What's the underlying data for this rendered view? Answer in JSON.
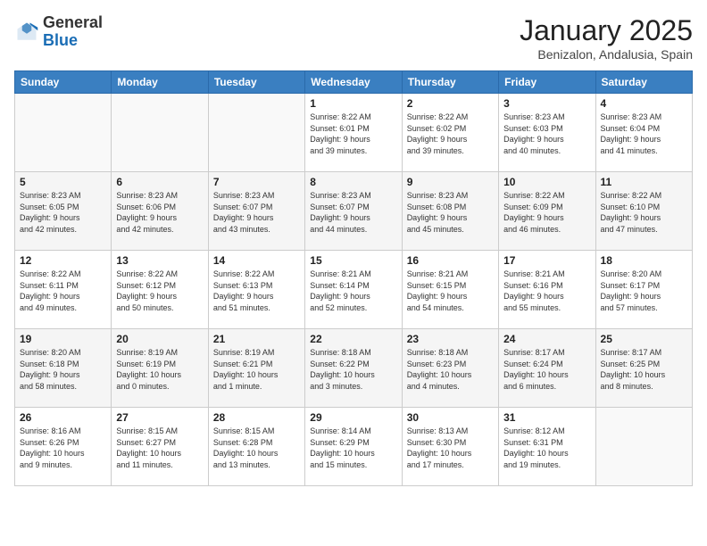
{
  "logo": {
    "general": "General",
    "blue": "Blue"
  },
  "header": {
    "month": "January 2025",
    "location": "Benizalon, Andalusia, Spain"
  },
  "weekdays": [
    "Sunday",
    "Monday",
    "Tuesday",
    "Wednesday",
    "Thursday",
    "Friday",
    "Saturday"
  ],
  "weeks": [
    [
      {
        "day": "",
        "info": ""
      },
      {
        "day": "",
        "info": ""
      },
      {
        "day": "",
        "info": ""
      },
      {
        "day": "1",
        "info": "Sunrise: 8:22 AM\nSunset: 6:01 PM\nDaylight: 9 hours\nand 39 minutes."
      },
      {
        "day": "2",
        "info": "Sunrise: 8:22 AM\nSunset: 6:02 PM\nDaylight: 9 hours\nand 39 minutes."
      },
      {
        "day": "3",
        "info": "Sunrise: 8:23 AM\nSunset: 6:03 PM\nDaylight: 9 hours\nand 40 minutes."
      },
      {
        "day": "4",
        "info": "Sunrise: 8:23 AM\nSunset: 6:04 PM\nDaylight: 9 hours\nand 41 minutes."
      }
    ],
    [
      {
        "day": "5",
        "info": "Sunrise: 8:23 AM\nSunset: 6:05 PM\nDaylight: 9 hours\nand 42 minutes."
      },
      {
        "day": "6",
        "info": "Sunrise: 8:23 AM\nSunset: 6:06 PM\nDaylight: 9 hours\nand 42 minutes."
      },
      {
        "day": "7",
        "info": "Sunrise: 8:23 AM\nSunset: 6:07 PM\nDaylight: 9 hours\nand 43 minutes."
      },
      {
        "day": "8",
        "info": "Sunrise: 8:23 AM\nSunset: 6:07 PM\nDaylight: 9 hours\nand 44 minutes."
      },
      {
        "day": "9",
        "info": "Sunrise: 8:23 AM\nSunset: 6:08 PM\nDaylight: 9 hours\nand 45 minutes."
      },
      {
        "day": "10",
        "info": "Sunrise: 8:22 AM\nSunset: 6:09 PM\nDaylight: 9 hours\nand 46 minutes."
      },
      {
        "day": "11",
        "info": "Sunrise: 8:22 AM\nSunset: 6:10 PM\nDaylight: 9 hours\nand 47 minutes."
      }
    ],
    [
      {
        "day": "12",
        "info": "Sunrise: 8:22 AM\nSunset: 6:11 PM\nDaylight: 9 hours\nand 49 minutes."
      },
      {
        "day": "13",
        "info": "Sunrise: 8:22 AM\nSunset: 6:12 PM\nDaylight: 9 hours\nand 50 minutes."
      },
      {
        "day": "14",
        "info": "Sunrise: 8:22 AM\nSunset: 6:13 PM\nDaylight: 9 hours\nand 51 minutes."
      },
      {
        "day": "15",
        "info": "Sunrise: 8:21 AM\nSunset: 6:14 PM\nDaylight: 9 hours\nand 52 minutes."
      },
      {
        "day": "16",
        "info": "Sunrise: 8:21 AM\nSunset: 6:15 PM\nDaylight: 9 hours\nand 54 minutes."
      },
      {
        "day": "17",
        "info": "Sunrise: 8:21 AM\nSunset: 6:16 PM\nDaylight: 9 hours\nand 55 minutes."
      },
      {
        "day": "18",
        "info": "Sunrise: 8:20 AM\nSunset: 6:17 PM\nDaylight: 9 hours\nand 57 minutes."
      }
    ],
    [
      {
        "day": "19",
        "info": "Sunrise: 8:20 AM\nSunset: 6:18 PM\nDaylight: 9 hours\nand 58 minutes."
      },
      {
        "day": "20",
        "info": "Sunrise: 8:19 AM\nSunset: 6:19 PM\nDaylight: 10 hours\nand 0 minutes."
      },
      {
        "day": "21",
        "info": "Sunrise: 8:19 AM\nSunset: 6:21 PM\nDaylight: 10 hours\nand 1 minute."
      },
      {
        "day": "22",
        "info": "Sunrise: 8:18 AM\nSunset: 6:22 PM\nDaylight: 10 hours\nand 3 minutes."
      },
      {
        "day": "23",
        "info": "Sunrise: 8:18 AM\nSunset: 6:23 PM\nDaylight: 10 hours\nand 4 minutes."
      },
      {
        "day": "24",
        "info": "Sunrise: 8:17 AM\nSunset: 6:24 PM\nDaylight: 10 hours\nand 6 minutes."
      },
      {
        "day": "25",
        "info": "Sunrise: 8:17 AM\nSunset: 6:25 PM\nDaylight: 10 hours\nand 8 minutes."
      }
    ],
    [
      {
        "day": "26",
        "info": "Sunrise: 8:16 AM\nSunset: 6:26 PM\nDaylight: 10 hours\nand 9 minutes."
      },
      {
        "day": "27",
        "info": "Sunrise: 8:15 AM\nSunset: 6:27 PM\nDaylight: 10 hours\nand 11 minutes."
      },
      {
        "day": "28",
        "info": "Sunrise: 8:15 AM\nSunset: 6:28 PM\nDaylight: 10 hours\nand 13 minutes."
      },
      {
        "day": "29",
        "info": "Sunrise: 8:14 AM\nSunset: 6:29 PM\nDaylight: 10 hours\nand 15 minutes."
      },
      {
        "day": "30",
        "info": "Sunrise: 8:13 AM\nSunset: 6:30 PM\nDaylight: 10 hours\nand 17 minutes."
      },
      {
        "day": "31",
        "info": "Sunrise: 8:12 AM\nSunset: 6:31 PM\nDaylight: 10 hours\nand 19 minutes."
      },
      {
        "day": "",
        "info": ""
      }
    ]
  ]
}
